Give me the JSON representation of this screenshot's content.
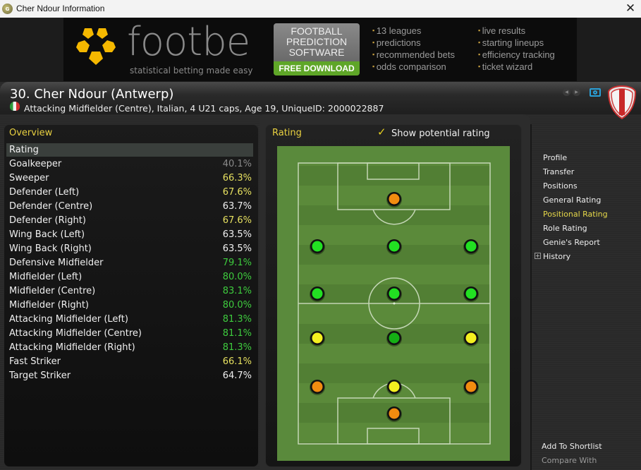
{
  "window": {
    "title": "Cher Ndour Information",
    "app_icon": "genie-scout-icon",
    "close_label": "✕"
  },
  "banner": {
    "logo_text": "footbe",
    "tagline": "statistical betting made easy",
    "promo_title": [
      "FOOTBALL",
      "PREDICTION",
      "SOFTWARE"
    ],
    "promo_cta": "FREE DOWNLOAD",
    "features_a": [
      "13 leagues",
      "predictions",
      "recommended bets",
      "odds comparison"
    ],
    "features_b": [
      "live results",
      "starting lineups",
      "efficiency tracking",
      "ticket wizard"
    ],
    "colors": {
      "logo_yellow": "#f5b800",
      "cta_green": "#5fa628"
    }
  },
  "player": {
    "title": "30. Cher Ndour (Antwerp)",
    "info": "Attacking Midfielder (Centre), Italian, 4 U21 caps, Age 19, UniqueID: 2000022887",
    "nationality_flag": "italy-flag"
  },
  "overview": {
    "heading": "Overview",
    "table_header": "Rating",
    "rows": [
      {
        "position": "Goalkeeper",
        "value": "40.1%",
        "color": "#8a8a8a"
      },
      {
        "position": "Sweeper",
        "value": "66.3%",
        "color": "#e6e060"
      },
      {
        "position": "Defender (Left)",
        "value": "67.6%",
        "color": "#e6e060"
      },
      {
        "position": "Defender (Centre)",
        "value": "63.7%",
        "color": "#f0f0f0"
      },
      {
        "position": "Defender (Right)",
        "value": "67.6%",
        "color": "#e6e060"
      },
      {
        "position": "Wing Back (Left)",
        "value": "63.5%",
        "color": "#f0f0f0"
      },
      {
        "position": "Wing Back (Right)",
        "value": "63.5%",
        "color": "#f0f0f0"
      },
      {
        "position": "Defensive Midfielder",
        "value": "79.1%",
        "color": "#3ecc3e"
      },
      {
        "position": "Midfielder (Left)",
        "value": "80.0%",
        "color": "#3ecc3e"
      },
      {
        "position": "Midfielder (Centre)",
        "value": "83.1%",
        "color": "#3ecc3e"
      },
      {
        "position": "Midfielder (Right)",
        "value": "80.0%",
        "color": "#3ecc3e"
      },
      {
        "position": "Attacking Midfielder (Left)",
        "value": "81.3%",
        "color": "#3ecc3e"
      },
      {
        "position": "Attacking Midfielder (Centre)",
        "value": "81.1%",
        "color": "#3ecc3e"
      },
      {
        "position": "Attacking Midfielder (Right)",
        "value": "81.3%",
        "color": "#3ecc3e"
      },
      {
        "position": "Fast Striker",
        "value": "66.1%",
        "color": "#e6e060"
      },
      {
        "position": "Target Striker",
        "value": "64.7%",
        "color": "#f0f0f0"
      }
    ]
  },
  "rating_panel": {
    "heading": "Rating",
    "show_potential_label": "Show potential rating",
    "show_potential_checked": true,
    "pitch_markers": [
      {
        "position": "Target Striker",
        "row": 0,
        "col": 1,
        "color": "#f28c10"
      },
      {
        "position": "Attacking Midfielder (Left)",
        "row": 1,
        "col": 0,
        "color": "#22e022"
      },
      {
        "position": "Attacking Midfielder (Centre)",
        "row": 1,
        "col": 1,
        "color": "#22e022"
      },
      {
        "position": "Attacking Midfielder (Right)",
        "row": 1,
        "col": 2,
        "color": "#22e022"
      },
      {
        "position": "Midfielder (Left)",
        "row": 2,
        "col": 0,
        "color": "#22e022"
      },
      {
        "position": "Midfielder (Centre)",
        "row": 2,
        "col": 1,
        "color": "#22e022"
      },
      {
        "position": "Midfielder (Right)",
        "row": 2,
        "col": 2,
        "color": "#22e022"
      },
      {
        "position": "Wing Back (Left)",
        "row": 3,
        "col": 0,
        "color": "#f4f020"
      },
      {
        "position": "Defensive Midfielder",
        "row": 3,
        "col": 1,
        "color": "#14b014"
      },
      {
        "position": "Wing Back (Right)",
        "row": 3,
        "col": 2,
        "color": "#f4f020"
      },
      {
        "position": "Defender (Left)",
        "row": 4,
        "col": 0,
        "color": "#f28c10"
      },
      {
        "position": "Defender (Centre)",
        "row": 4,
        "col": 1,
        "color": "#f4f020"
      },
      {
        "position": "Defender (Right)",
        "row": 4,
        "col": 2,
        "color": "#f28c10"
      },
      {
        "position": "Sweeper",
        "row": 5,
        "col": 1,
        "color": "#f28c10"
      }
    ]
  },
  "side_menu": {
    "items": [
      {
        "label": "Profile",
        "active": false
      },
      {
        "label": "Transfer",
        "active": false
      },
      {
        "label": "Positions",
        "active": false
      },
      {
        "label": "General Rating",
        "active": false
      },
      {
        "label": "Positional Rating",
        "active": true
      },
      {
        "label": "Role Rating",
        "active": false
      },
      {
        "label": "Genie's Report",
        "active": false
      },
      {
        "label": "History",
        "active": false,
        "expandable": true
      }
    ],
    "bottom": [
      {
        "label": "Add To Shortlist",
        "enabled": true
      },
      {
        "label": "Compare With",
        "enabled": false
      }
    ]
  }
}
